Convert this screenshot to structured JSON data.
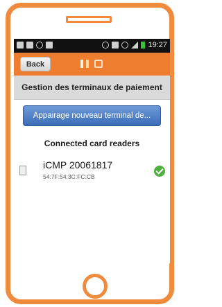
{
  "status_bar": {
    "time": "19:27",
    "left_icons": [
      "notification-icon",
      "notification-icon",
      "whatsapp-icon",
      "image-icon"
    ],
    "right_icons": [
      "bluetooth-icon",
      "nfc-icon",
      "wifi-icon",
      "signal-icon",
      "battery-icon"
    ]
  },
  "action_bar": {
    "back_label": "Back",
    "icons": [
      "network-icon",
      "storage-icon"
    ],
    "color": "#ef7d2f"
  },
  "page": {
    "title": "Gestion des terminaux de paiement",
    "pair_button_label": "Appairage nouveau terminal de...",
    "pair_button_color": "#4a7cc4",
    "section_header": "Connected card readers"
  },
  "readers": [
    {
      "name": "iCMP 20061817",
      "mac": "54:7F:54:3C:FC:CB",
      "status": "connected"
    }
  ],
  "device": {
    "frame_color": "#f08a3c"
  }
}
